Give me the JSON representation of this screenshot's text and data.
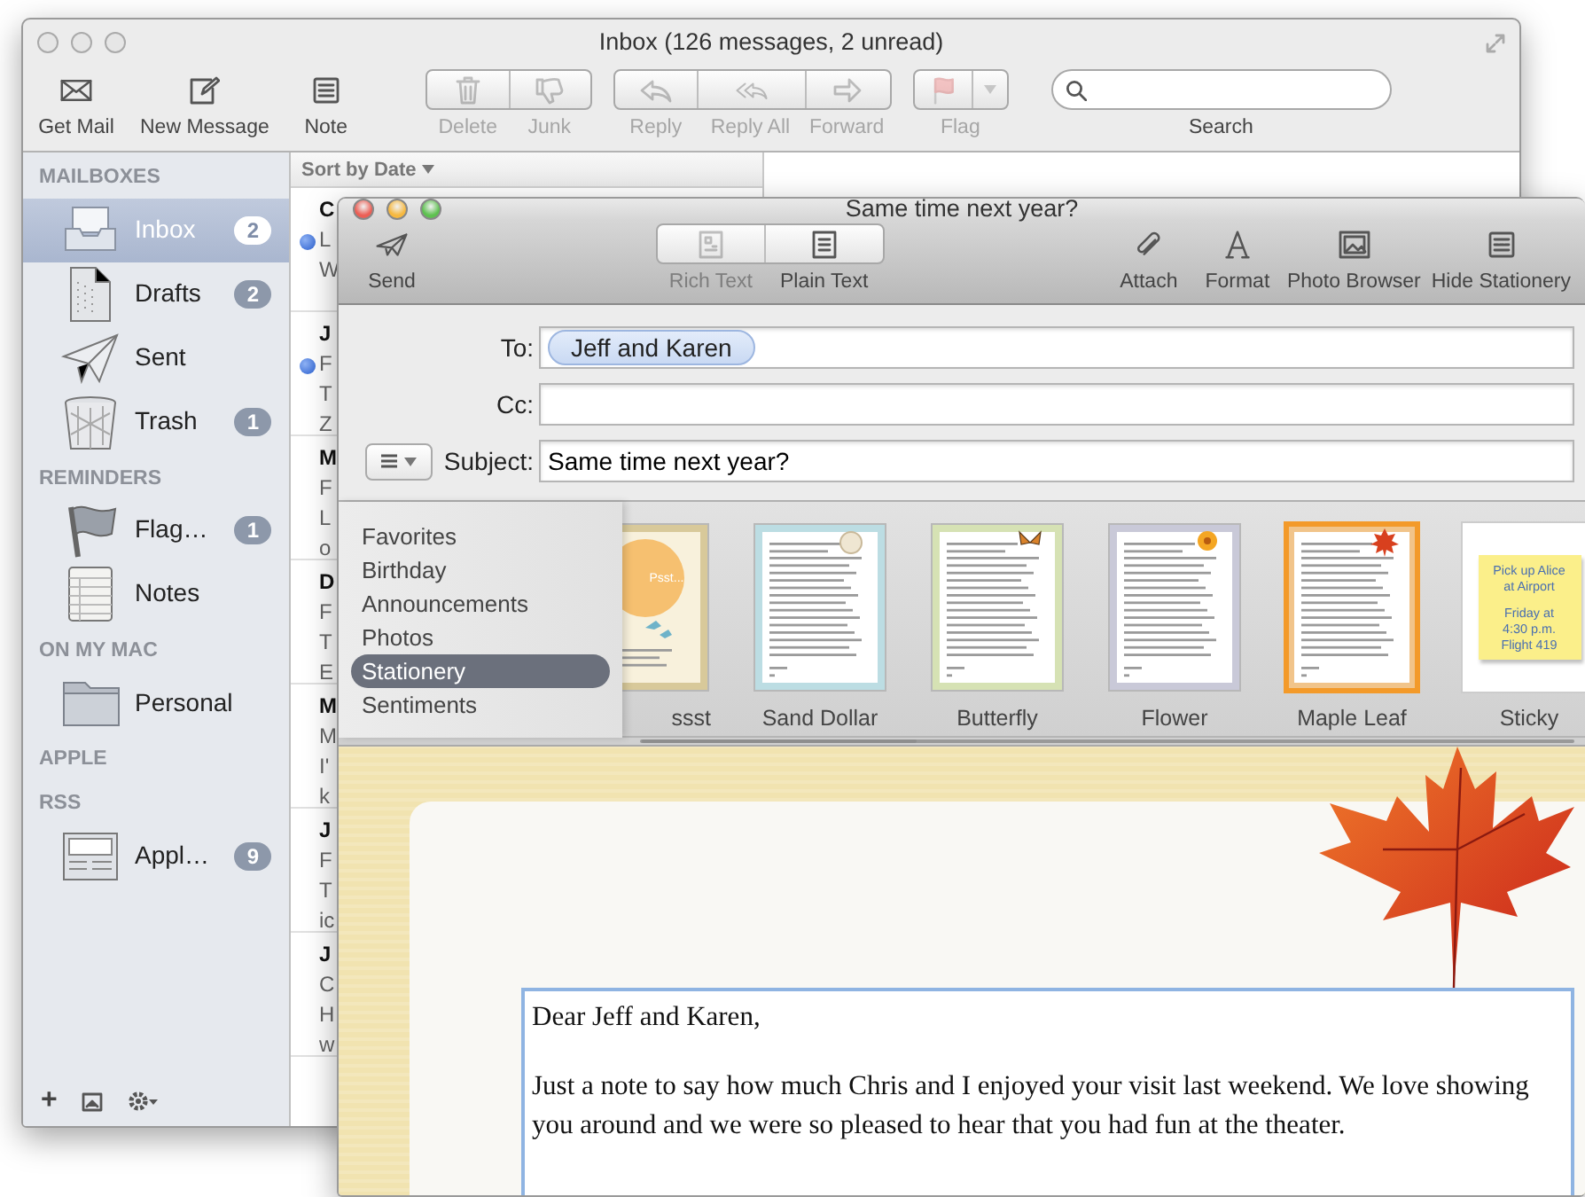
{
  "inbox_window": {
    "title": "Inbox (126 messages, 2 unread)",
    "toolbar": [
      {
        "kind": "single",
        "buttons": [
          {
            "label": "Get Mail",
            "disabled": false
          }
        ]
      },
      {
        "kind": "single",
        "buttons": [
          {
            "label": "New Message",
            "disabled": false
          }
        ]
      },
      {
        "kind": "single",
        "buttons": [
          {
            "label": "Note",
            "disabled": false
          }
        ]
      },
      {
        "kind": "segmented",
        "buttons": [
          {
            "label": "Delete",
            "disabled": true
          },
          {
            "label": "Junk",
            "disabled": true
          }
        ]
      },
      {
        "kind": "segmented",
        "buttons": [
          {
            "label": "Reply",
            "disabled": true
          },
          {
            "label": "Reply All",
            "disabled": true
          },
          {
            "label": "Forward",
            "disabled": true
          }
        ]
      },
      {
        "kind": "menu",
        "buttons": [
          {
            "label": "Flag",
            "disabled": true
          }
        ]
      },
      {
        "kind": "search",
        "label": "Search"
      }
    ],
    "sidebar": {
      "sections": [
        {
          "heading": "MAILBOXES",
          "items": [
            {
              "label": "Inbox",
              "count": "2",
              "selected": true
            },
            {
              "label": "Drafts",
              "count": "2",
              "selected": false
            },
            {
              "label": "Sent",
              "selected": false
            },
            {
              "label": "Trash",
              "count": "1",
              "selected": false
            }
          ]
        },
        {
          "heading": "REMINDERS",
          "items": [
            {
              "label": "Flag…",
              "count": "1",
              "selected": false
            },
            {
              "label": "Notes",
              "selected": false
            }
          ]
        },
        {
          "heading": "ON MY MAC",
          "items": [
            {
              "label": "Personal",
              "selected": false
            }
          ]
        },
        {
          "heading": "APPLE"
        },
        {
          "heading": "RSS",
          "items": [
            {
              "label": "Appl…",
              "count": "9",
              "selected": false
            }
          ]
        }
      ],
      "footer": {
        "add": "+"
      }
    },
    "message_list": {
      "sort_label": "Sort by Date",
      "rows": [
        {
          "unread": true,
          "lines": [
            "C",
            "L",
            "W"
          ]
        },
        {
          "unread": true,
          "lines": [
            "J",
            "F",
            "T",
            "Z"
          ]
        },
        {
          "unread": false,
          "lines": [
            "M",
            "F",
            "L",
            "o"
          ]
        },
        {
          "unread": false,
          "lines": [
            "D",
            "F",
            "T",
            "E"
          ]
        },
        {
          "unread": false,
          "lines": [
            "M",
            "M",
            "I'",
            "k"
          ]
        },
        {
          "unread": false,
          "lines": [
            "J",
            "F",
            "T",
            "ic"
          ]
        },
        {
          "unread": false,
          "lines": [
            "J",
            "C",
            "H",
            "w"
          ]
        }
      ]
    }
  },
  "compose_window": {
    "title": "Same time next year?",
    "toolbar": [
      {
        "kind": "single",
        "buttons": [
          {
            "label": "Send",
            "disabled": false
          }
        ]
      },
      {
        "kind": "segmented",
        "buttons": [
          {
            "label": "Rich Text",
            "disabled": true
          },
          {
            "label": "Plain Text",
            "disabled": false
          }
        ]
      },
      {
        "kind": "single",
        "buttons": [
          {
            "label": "Attach",
            "disabled": false
          }
        ]
      },
      {
        "kind": "single",
        "buttons": [
          {
            "label": "Format",
            "disabled": false
          }
        ]
      },
      {
        "kind": "single",
        "buttons": [
          {
            "label": "Photo Browser",
            "disabled": false
          }
        ]
      },
      {
        "kind": "single",
        "buttons": [
          {
            "label": "Hide Stationery",
            "disabled": false
          }
        ]
      }
    ],
    "to": {
      "label": "To:",
      "recipients": [
        "Jeff and Karen"
      ]
    },
    "cc": {
      "label": "Cc:"
    },
    "subject": {
      "label": "Subject:",
      "value": "Same time next year?"
    },
    "stationery": {
      "categories": [
        {
          "label": "Favorites",
          "selected": false
        },
        {
          "label": "Birthday",
          "selected": false
        },
        {
          "label": "Announcements",
          "selected": false
        },
        {
          "label": "Photos",
          "selected": false
        },
        {
          "label": "Stationery",
          "selected": true
        },
        {
          "label": "Sentiments",
          "selected": false
        }
      ],
      "thumbnails": [
        {
          "kind": "card",
          "label": "ssst",
          "text": "Psst...",
          "selected": false
        },
        {
          "kind": "letter",
          "label": "Sand Dollar",
          "color": "#bcdde3",
          "selected": false
        },
        {
          "kind": "letter",
          "label": "Butterfly",
          "color": "#d6e2b4",
          "selected": false
        },
        {
          "kind": "letter",
          "label": "Flower",
          "color": "#c9c9d8",
          "selected": false
        },
        {
          "kind": "letter",
          "label": "Maple Leaf",
          "color": "#f1c48a",
          "selected": true
        },
        {
          "kind": "sticky",
          "label": "Sticky",
          "lines": [
            "Pick up Alice",
            "at Airport",
            "Friday at",
            "4:30 p.m.",
            "Flight 419"
          ],
          "selected": false
        }
      ]
    },
    "body": {
      "greeting": "Dear Jeff and Karen,",
      "paragraph": "Just a note to say how much Chris and I enjoyed your visit last weekend. We love showing you around and we were so pleased to hear that you had fun at the theater."
    }
  }
}
